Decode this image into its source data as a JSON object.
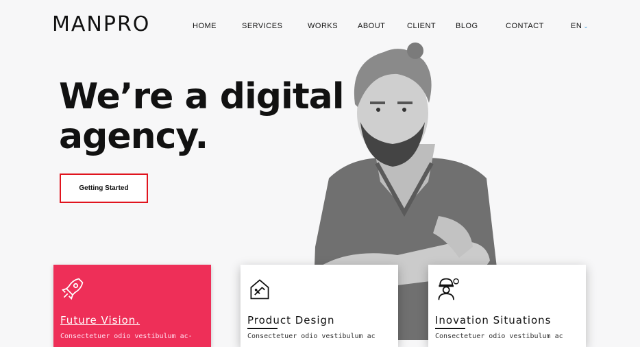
{
  "brand": {
    "logo": "MANPRO"
  },
  "nav": {
    "items": [
      "HOME",
      "SERVICES",
      "WORKS",
      "ABOUT",
      "CLIENT",
      "BLOG",
      "CONTACT"
    ],
    "language": "EN"
  },
  "hero": {
    "title_line1": "We’re a digital",
    "title_line2": "agency.",
    "cta_label": "Getting Started"
  },
  "cards": [
    {
      "title": "Future Vision.",
      "text": "Consectetuer odio vestibulum ac-",
      "icon": "rocket-icon"
    },
    {
      "title": "Product Design",
      "text": "Consectetuer odio vestibulum ac",
      "icon": "design-tools-icon"
    },
    {
      "title": "Inovation Situations",
      "text": "Consectetuer odio vestibulum ac",
      "icon": "engineer-icon"
    }
  ],
  "colors": {
    "accent": "#ee2f58",
    "cta_border": "#e0141e",
    "lang_caret": "#4aa3df",
    "background": "#f7f7f8"
  }
}
